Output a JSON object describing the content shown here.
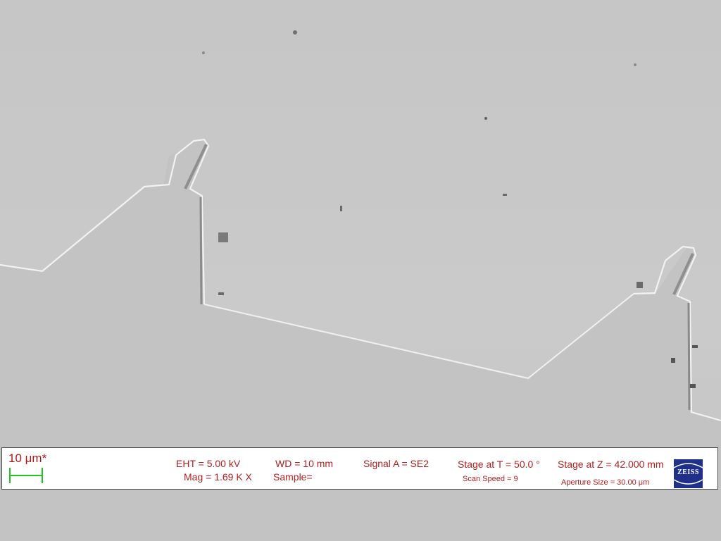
{
  "scalebar": {
    "label": "10 μm*"
  },
  "params": {
    "eht": "EHT =  5.00 kV",
    "mag": "Mag =   1.69 K X",
    "wd": "WD =   10 mm",
    "sample": "Sample=",
    "signal": "Signal A = SE2",
    "tilt": "Stage at T =  50.0 °",
    "scan_speed": "Scan Speed = 9",
    "stage_z": "Stage at Z = 42.000 mm",
    "aperture": "Aperture Size = 30.00 μm"
  },
  "logo": {
    "text": "ZEISS"
  },
  "colors": {
    "background": "#c9c9c9",
    "text_red": "#b02020",
    "scalebar_green": "#22c322",
    "logo_blue": "#1f2f8a"
  }
}
